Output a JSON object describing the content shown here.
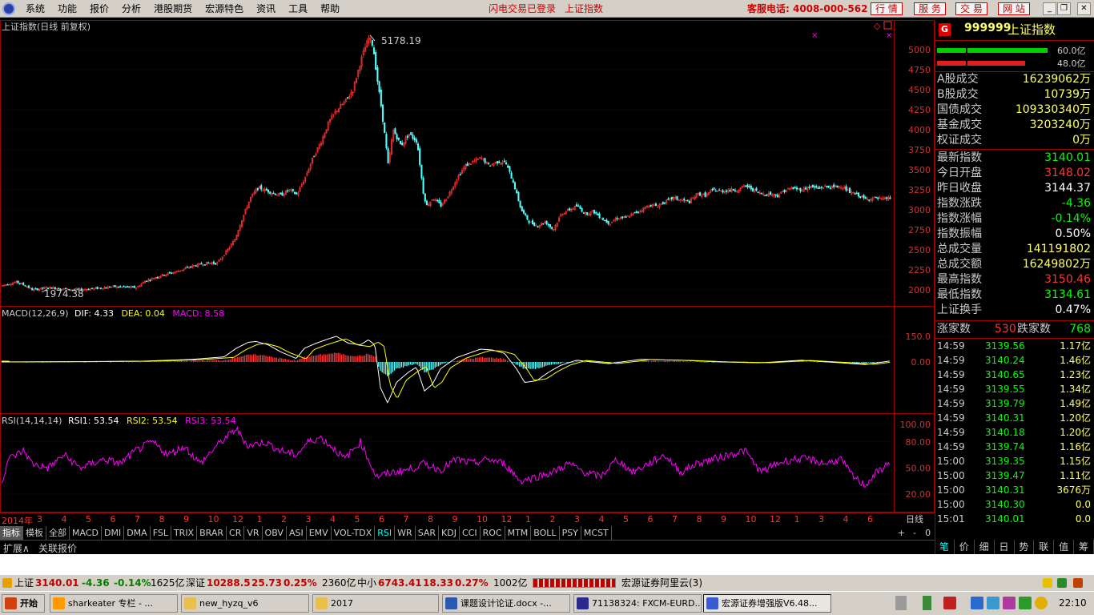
{
  "menu": {
    "items": [
      "系统",
      "功能",
      "报价",
      "分析",
      "港股期货",
      "宏源特色",
      "资讯",
      "工具",
      "帮助"
    ],
    "login_status": "闪电交易已登录",
    "index_link": "上证指数",
    "hotline": "客服电话: 4008-000-562",
    "buttons": [
      "行 情",
      "服 务",
      "交 易",
      "网 站"
    ]
  },
  "chart_header": {
    "title": "上证指数(日线 前复权)",
    "high_label": "5178.19",
    "low_label": "1974.38"
  },
  "price_axis": [
    "5000",
    "4750",
    "4500",
    "4250",
    "4000",
    "3750",
    "3500",
    "3250",
    "3000",
    "2750",
    "2500",
    "2250",
    "2000"
  ],
  "macd": {
    "name": "MACD(12,26,9)",
    "dif_label": "DIF:",
    "dif": "4.33",
    "dea_label": "DEA:",
    "dea": "0.04",
    "macd_label": "MACD:",
    "macd": "8.58",
    "axis": [
      "150.0",
      "0.00"
    ]
  },
  "rsi": {
    "name": "RSI(14,14,14)",
    "rsi1_label": "RSI1:",
    "rsi1": "53.54",
    "rsi2_label": "RSI2:",
    "rsi2": "53.54",
    "rsi3_label": "RSI3:",
    "rsi3": "53.54",
    "axis": [
      "100.00",
      "80.00",
      "50.00",
      "20.00"
    ]
  },
  "time_axis": {
    "first": "2014年",
    "months": [
      "3",
      "4",
      "5",
      "6",
      "7",
      "8",
      "9",
      "10",
      "12",
      "1",
      "2",
      "3",
      "4",
      "5",
      "6",
      "7",
      "8",
      "9",
      "10",
      "12",
      "1",
      "2",
      "3",
      "4",
      "5",
      "6",
      "7",
      "8",
      "9",
      "10",
      "12",
      "1",
      "3",
      "4",
      "6"
    ],
    "period": "日线"
  },
  "indicator_tabs": [
    "指标",
    "模板",
    "全部",
    "MACD",
    "DMI",
    "DMA",
    "FSL",
    "TRIX",
    "BRAR",
    "CR",
    "VR",
    "OBV",
    "ASI",
    "EMV",
    "VOL-TDX",
    "RSI",
    "WR",
    "SAR",
    "KDJ",
    "CCI",
    "ROC",
    "MTM",
    "BOLL",
    "PSY",
    "MCST"
  ],
  "active_indicator": "RSI",
  "zoom_controls": [
    "+",
    "-",
    "0"
  ],
  "ext_tabs": [
    "扩展∧",
    "关联报价"
  ],
  "quote": {
    "badge": "G",
    "code": "999999",
    "name": "上证指数",
    "bar1_label": "60.0亿",
    "bar2_label": "48.0亿",
    "volume_rows": [
      {
        "k": "A股成交",
        "v": "16239062万"
      },
      {
        "k": "B股成交",
        "v": "10739万"
      },
      {
        "k": "国债成交",
        "v": "109330340万"
      },
      {
        "k": "基金成交",
        "v": "3203240万"
      },
      {
        "k": "权证成交",
        "v": "0万"
      }
    ],
    "index_rows": [
      {
        "k": "最新指数",
        "v": "3140.01",
        "c": "#00ff00"
      },
      {
        "k": "今日开盘",
        "v": "3148.02",
        "c": "#ff3333"
      },
      {
        "k": "昨日收盘",
        "v": "3144.37",
        "c": "#ffffff"
      },
      {
        "k": "指数涨跌",
        "v": "-4.36",
        "c": "#00ff00"
      },
      {
        "k": "指数涨幅",
        "v": "-0.14%",
        "c": "#00ff00"
      },
      {
        "k": "指数振幅",
        "v": "0.50%",
        "c": "#ffffff"
      },
      {
        "k": "总成交量",
        "v": "141191802",
        "c": "#ffff66"
      },
      {
        "k": "总成交额",
        "v": "16249802万",
        "c": "#ffff66"
      },
      {
        "k": "最高指数",
        "v": "3150.46",
        "c": "#ff3333"
      },
      {
        "k": "最低指数",
        "v": "3134.61",
        "c": "#00ff00"
      },
      {
        "k": "上证换手",
        "v": "0.47%",
        "c": "#ffffff"
      }
    ],
    "up_label": "涨家数",
    "up_count": "530",
    "down_label": "跌家数",
    "down_count": "768"
  },
  "ticks": [
    {
      "t": "14:59",
      "p": "3139.56",
      "v": "1.17亿"
    },
    {
      "t": "14:59",
      "p": "3140.24",
      "v": "1.46亿"
    },
    {
      "t": "14:59",
      "p": "3140.65",
      "v": "1.23亿"
    },
    {
      "t": "14:59",
      "p": "3139.55",
      "v": "1.34亿"
    },
    {
      "t": "14:59",
      "p": "3139.79",
      "v": "1.49亿"
    },
    {
      "t": "14:59",
      "p": "3140.31",
      "v": "1.20亿"
    },
    {
      "t": "14:59",
      "p": "3140.18",
      "v": "1.20亿"
    },
    {
      "t": "14:59",
      "p": "3139.74",
      "v": "1.16亿"
    },
    {
      "t": "15:00",
      "p": "3139.35",
      "v": "1.15亿"
    },
    {
      "t": "15:00",
      "p": "3139.47",
      "v": "1.11亿"
    },
    {
      "t": "15:00",
      "p": "3140.31",
      "v": "3676万"
    },
    {
      "t": "15:00",
      "p": "3140.30",
      "v": "0.0"
    },
    {
      "t": "15:01",
      "p": "3140.01",
      "v": "0.0"
    }
  ],
  "bottom_tabs": [
    "笔",
    "价",
    "细",
    "日",
    "势",
    "联",
    "值",
    "筹"
  ],
  "status": {
    "sh_label": "上证",
    "sh_value": "3140.01",
    "sh_change": "-4.36",
    "sh_pct": "-0.14%",
    "sh_amount": "1625亿",
    "sz_label": "深证",
    "sz_value": "10288.5",
    "sz_change": "25.73",
    "sz_pct": "0.25%",
    "sz_amount": "2360亿",
    "zx_label": "中小",
    "zx_value": "6743.41",
    "zx_change": "18.33",
    "zx_pct": "0.27%",
    "zx_amount": "1002亿",
    "server": "宏源证券阿里云(3)"
  },
  "taskbar": {
    "start": "开始",
    "tasks": [
      "sharkeater 专栏 - ...",
      "new_hyzq_v6",
      "2017",
      "课题设计论证.docx -...",
      "71138324: FXCM-EURD...",
      "宏源证券增强版V6.48..."
    ],
    "active_task": 5,
    "clock": "22:10"
  },
  "colors": {
    "up": "#ff3333",
    "down": "#54ffff",
    "border": "#a00000",
    "dif": "#ffffff",
    "dea": "#ffff00",
    "rsi": "#ff00ff"
  },
  "chart_data": {
    "type": "line",
    "title": "上证指数(日线 前复权)",
    "note_marks": {
      "high": 5178.19,
      "low": 1974.38
    },
    "ylim": [
      1850,
      5250
    ],
    "close_anchors": [
      [
        0,
        2050
      ],
      [
        20,
        2100
      ],
      [
        30,
        2060
      ],
      [
        40,
        2000
      ],
      [
        60,
        2030
      ],
      [
        90,
        2000
      ],
      [
        110,
        2010
      ],
      [
        140,
        2040
      ],
      [
        170,
        2030
      ],
      [
        180,
        2110
      ],
      [
        200,
        2180
      ],
      [
        220,
        2230
      ],
      [
        240,
        2300
      ],
      [
        260,
        2340
      ],
      [
        270,
        2330
      ],
      [
        282,
        2480
      ],
      [
        292,
        2620
      ],
      [
        302,
        2900
      ],
      [
        312,
        3150
      ],
      [
        322,
        3280
      ],
      [
        332,
        3240
      ],
      [
        340,
        3210
      ],
      [
        350,
        3180
      ],
      [
        360,
        3250
      ],
      [
        370,
        3190
      ],
      [
        380,
        3400
      ],
      [
        390,
        3650
      ],
      [
        400,
        3850
      ],
      [
        410,
        4100
      ],
      [
        420,
        4250
      ],
      [
        430,
        4350
      ],
      [
        440,
        4500
      ],
      [
        448,
        4800
      ],
      [
        454,
        5000
      ],
      [
        460,
        5150
      ],
      [
        465,
        5050
      ],
      [
        470,
        4650
      ],
      [
        475,
        4300
      ],
      [
        480,
        3900
      ],
      [
        484,
        3550
      ],
      [
        490,
        4000
      ],
      [
        500,
        3800
      ],
      [
        510,
        3950
      ],
      [
        520,
        3850
      ],
      [
        528,
        3200
      ],
      [
        532,
        3050
      ],
      [
        540,
        3150
      ],
      [
        550,
        3050
      ],
      [
        560,
        3200
      ],
      [
        570,
        3400
      ],
      [
        580,
        3550
      ],
      [
        590,
        3600
      ],
      [
        600,
        3650
      ],
      [
        610,
        3550
      ],
      [
        620,
        3600
      ],
      [
        630,
        3600
      ],
      [
        640,
        3350
      ],
      [
        650,
        3000
      ],
      [
        660,
        2850
      ],
      [
        670,
        2800
      ],
      [
        680,
        2850
      ],
      [
        690,
        2750
      ],
      [
        700,
        2950
      ],
      [
        710,
        3000
      ],
      [
        720,
        3050
      ],
      [
        730,
        2950
      ],
      [
        740,
        2980
      ],
      [
        750,
        2900
      ],
      [
        760,
        2830
      ],
      [
        770,
        2900
      ],
      [
        780,
        2900
      ],
      [
        790,
        2950
      ],
      [
        800,
        3000
      ],
      [
        810,
        3060
      ],
      [
        820,
        3050
      ],
      [
        830,
        3100
      ],
      [
        840,
        3150
      ],
      [
        850,
        3120
      ],
      [
        860,
        3100
      ],
      [
        870,
        3200
      ],
      [
        880,
        3180
      ],
      [
        890,
        3250
      ],
      [
        900,
        3230
      ],
      [
        910,
        3250
      ],
      [
        920,
        3250
      ],
      [
        930,
        3300
      ],
      [
        940,
        3250
      ],
      [
        950,
        3200
      ],
      [
        960,
        3200
      ],
      [
        970,
        3180
      ],
      [
        980,
        3250
      ],
      [
        990,
        3270
      ],
      [
        1000,
        3250
      ],
      [
        1010,
        3290
      ],
      [
        1020,
        3270
      ],
      [
        1030,
        3290
      ],
      [
        1040,
        3280
      ],
      [
        1050,
        3300
      ],
      [
        1060,
        3220
      ],
      [
        1070,
        3190
      ],
      [
        1080,
        3130
      ],
      [
        1090,
        3150
      ],
      [
        1100,
        3130
      ],
      [
        1110,
        3150
      ]
    ],
    "macd_anchors": [
      [
        0,
        0
      ],
      [
        100,
        2
      ],
      [
        180,
        5
      ],
      [
        240,
        15
      ],
      [
        280,
        30
      ],
      [
        295,
        80
      ],
      [
        310,
        115
      ],
      [
        320,
        120
      ],
      [
        335,
        100
      ],
      [
        350,
        60
      ],
      [
        370,
        20
      ],
      [
        380,
        80
      ],
      [
        395,
        110
      ],
      [
        410,
        135
      ],
      [
        420,
        150
      ],
      [
        435,
        110
      ],
      [
        450,
        100
      ],
      [
        460,
        130
      ],
      [
        468,
        100
      ],
      [
        475,
        -150
      ],
      [
        484,
        -240
      ],
      [
        495,
        -120
      ],
      [
        510,
        -60
      ],
      [
        520,
        -30
      ],
      [
        530,
        -170
      ],
      [
        540,
        -130
      ],
      [
        550,
        -40
      ],
      [
        570,
        25
      ],
      [
        600,
        75
      ],
      [
        615,
        70
      ],
      [
        630,
        50
      ],
      [
        645,
        -40
      ],
      [
        655,
        -120
      ],
      [
        670,
        -110
      ],
      [
        685,
        -60
      ],
      [
        700,
        -20
      ],
      [
        720,
        10
      ],
      [
        760,
        -10
      ],
      [
        800,
        15
      ],
      [
        850,
        10
      ],
      [
        900,
        0
      ],
      [
        950,
        -5
      ],
      [
        1000,
        10
      ],
      [
        1050,
        -5
      ],
      [
        1080,
        -15
      ],
      [
        1110,
        5
      ]
    ],
    "rsi_anchors": [
      [
        0,
        25
      ],
      [
        10,
        60
      ],
      [
        30,
        70
      ],
      [
        40,
        55
      ],
      [
        60,
        50
      ],
      [
        80,
        65
      ],
      [
        100,
        50
      ],
      [
        130,
        60
      ],
      [
        150,
        55
      ],
      [
        170,
        70
      ],
      [
        190,
        80
      ],
      [
        210,
        65
      ],
      [
        230,
        75
      ],
      [
        250,
        55
      ],
      [
        270,
        75
      ],
      [
        295,
        95
      ],
      [
        310,
        75
      ],
      [
        330,
        80
      ],
      [
        350,
        70
      ],
      [
        370,
        65
      ],
      [
        385,
        80
      ],
      [
        400,
        85
      ],
      [
        420,
        70
      ],
      [
        430,
        60
      ],
      [
        450,
        80
      ],
      [
        470,
        40
      ],
      [
        490,
        45
      ],
      [
        510,
        48
      ],
      [
        530,
        55
      ],
      [
        550,
        48
      ],
      [
        570,
        60
      ],
      [
        590,
        55
      ],
      [
        610,
        60
      ],
      [
        630,
        55
      ],
      [
        650,
        35
      ],
      [
        670,
        40
      ],
      [
        690,
        45
      ],
      [
        710,
        55
      ],
      [
        730,
        45
      ],
      [
        750,
        40
      ],
      [
        770,
        60
      ],
      [
        790,
        45
      ],
      [
        810,
        55
      ],
      [
        830,
        65
      ],
      [
        850,
        45
      ],
      [
        870,
        55
      ],
      [
        890,
        60
      ],
      [
        910,
        65
      ],
      [
        930,
        70
      ],
      [
        950,
        45
      ],
      [
        970,
        55
      ],
      [
        990,
        60
      ],
      [
        1010,
        60
      ],
      [
        1030,
        55
      ],
      [
        1050,
        60
      ],
      [
        1065,
        40
      ],
      [
        1080,
        30
      ],
      [
        1095,
        45
      ],
      [
        1110,
        55
      ]
    ]
  }
}
